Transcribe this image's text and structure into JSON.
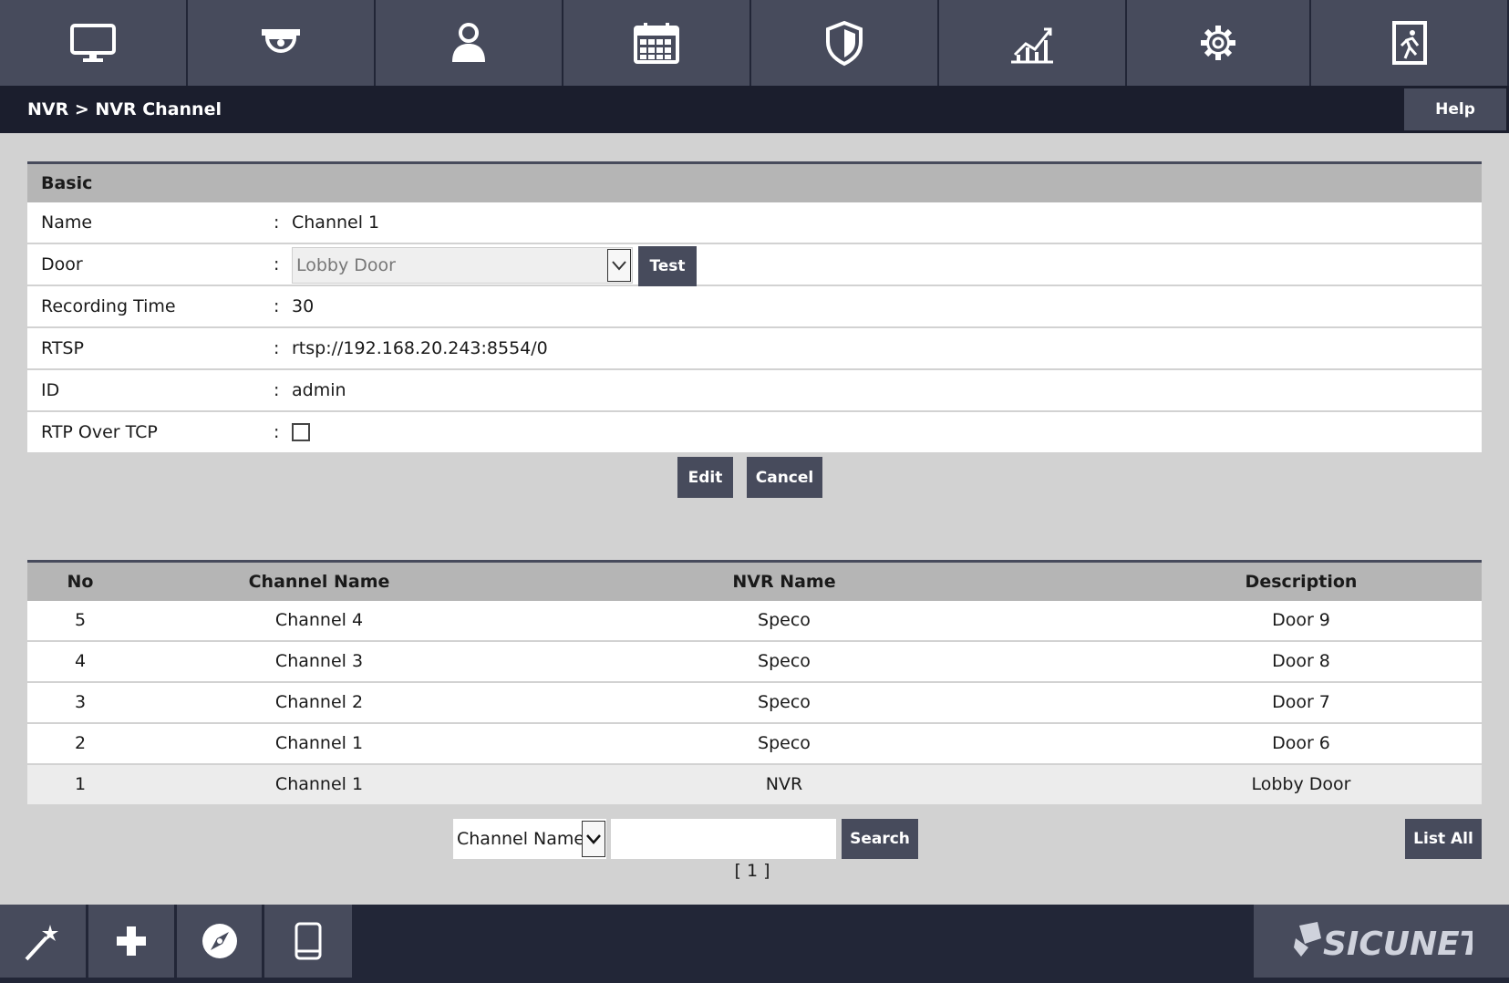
{
  "topnav": {
    "items": [
      {
        "icon": "monitor-icon"
      },
      {
        "icon": "camera-icon"
      },
      {
        "icon": "user-icon"
      },
      {
        "icon": "calendar-icon"
      },
      {
        "icon": "shield-icon"
      },
      {
        "icon": "chart-icon"
      },
      {
        "icon": "gear-icon"
      },
      {
        "icon": "exit-door-icon"
      }
    ]
  },
  "header": {
    "breadcrumb": "NVR > NVR Channel",
    "help_label": "Help"
  },
  "basic": {
    "section_title": "Basic",
    "colon": ":",
    "fields": {
      "name": {
        "label": "Name",
        "value": "Channel 1"
      },
      "door": {
        "label": "Door",
        "value": "Lobby Door",
        "test_label": "Test"
      },
      "recording_time": {
        "label": "Recording Time",
        "value": "30"
      },
      "rtsp": {
        "label": "RTSP",
        "value": "rtsp://192.168.20.243:8554/0"
      },
      "id": {
        "label": "ID",
        "value": "admin"
      },
      "rtp_over_tcp": {
        "label": "RTP Over TCP",
        "checked": false
      }
    },
    "edit_label": "Edit",
    "cancel_label": "Cancel"
  },
  "table": {
    "columns": [
      "No",
      "Channel Name",
      "NVR Name",
      "Description"
    ],
    "rows": [
      [
        "5",
        "Channel 4",
        "Speco",
        "Door 9"
      ],
      [
        "4",
        "Channel 3",
        "Speco",
        "Door 8"
      ],
      [
        "3",
        "Channel 2",
        "Speco",
        "Door 7"
      ],
      [
        "2",
        "Channel 1",
        "Speco",
        "Door 6"
      ],
      [
        "1",
        "Channel 1",
        "NVR",
        "Lobby Door"
      ]
    ],
    "selected_row": 4
  },
  "search": {
    "field_selected": "Channel Name",
    "query": "",
    "search_label": "Search",
    "list_all_label": "List All",
    "pager": "[ 1 ]"
  },
  "bottombar": {
    "items": [
      {
        "icon": "magic-wand-icon"
      },
      {
        "icon": "plus-icon"
      },
      {
        "icon": "compass-icon"
      },
      {
        "icon": "tablet-icon"
      }
    ],
    "logo_text": "SICUNET"
  },
  "colors": {
    "nav_dark": "#222637",
    "nav_button": "#474b5c",
    "title_bar": "#1b1e2d",
    "page_bg": "#d2d2d2",
    "header_gray": "#b5b5b5"
  }
}
